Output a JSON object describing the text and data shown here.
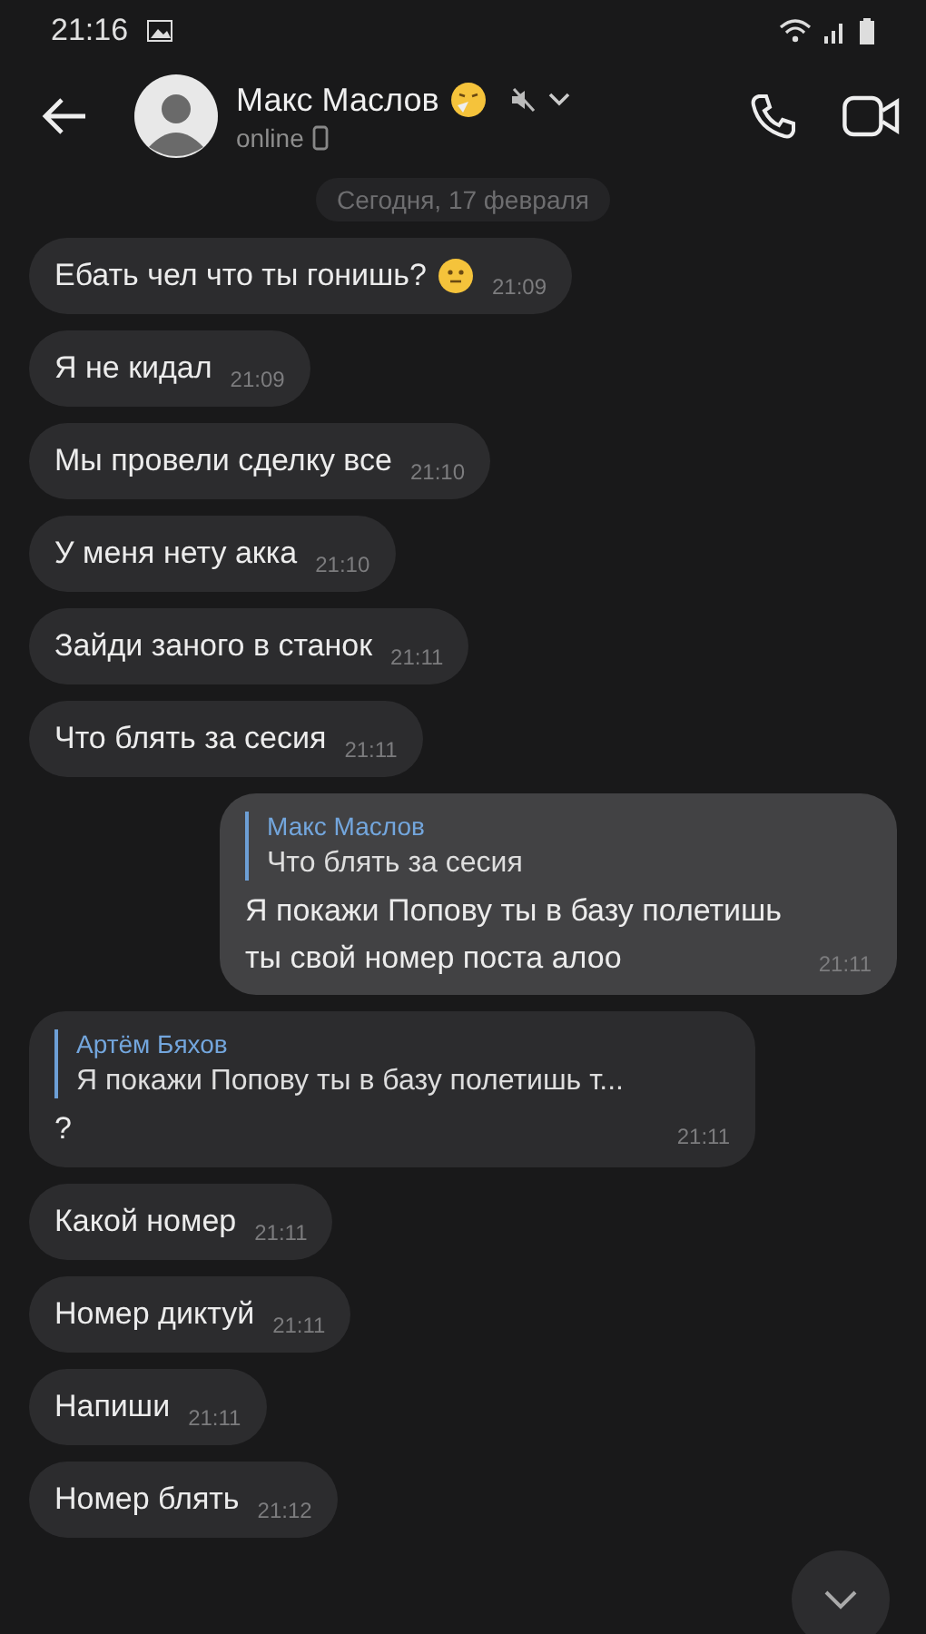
{
  "status_bar": {
    "time": "21:16"
  },
  "header": {
    "name": "Макс Маслов",
    "status": "online",
    "muted": true
  },
  "date_badge": "Сегодня, 17 февраля",
  "messages": [
    {
      "kind": "text",
      "outgoing": false,
      "text": "Ебать чел что ты гонишь?",
      "emoji": true,
      "time": "21:09"
    },
    {
      "kind": "text",
      "outgoing": false,
      "text": "Я не кидал",
      "time": "21:09"
    },
    {
      "kind": "text",
      "outgoing": false,
      "text": "Мы провели сделку все",
      "time": "21:10"
    },
    {
      "kind": "text",
      "outgoing": false,
      "text": "У меня нету акка",
      "time": "21:10"
    },
    {
      "kind": "text",
      "outgoing": false,
      "text": "Зайди заного в станок",
      "time": "21:11"
    },
    {
      "kind": "text",
      "outgoing": false,
      "text": "Что блять за сесия",
      "time": "21:11"
    },
    {
      "kind": "reply",
      "outgoing": true,
      "reply_author": "Макс Маслов",
      "reply_text": "Что блять за сесия",
      "text": "Я покажи Попову ты в базу полетишь ты свой номер поста алоо",
      "time": "21:11"
    },
    {
      "kind": "reply",
      "outgoing": false,
      "reply_author": "Артём Бяхов",
      "reply_text": "Я покажи Попову ты в базу полетишь т...",
      "text": "?",
      "time": "21:11"
    },
    {
      "kind": "text",
      "outgoing": false,
      "text": "Какой номер",
      "time": "21:11"
    },
    {
      "kind": "text",
      "outgoing": false,
      "text": "Номер диктуй",
      "time": "21:11"
    },
    {
      "kind": "text",
      "outgoing": false,
      "text": "Напиши",
      "time": "21:11"
    },
    {
      "kind": "text",
      "outgoing": false,
      "text": "Номер блять",
      "time": "21:12"
    }
  ]
}
